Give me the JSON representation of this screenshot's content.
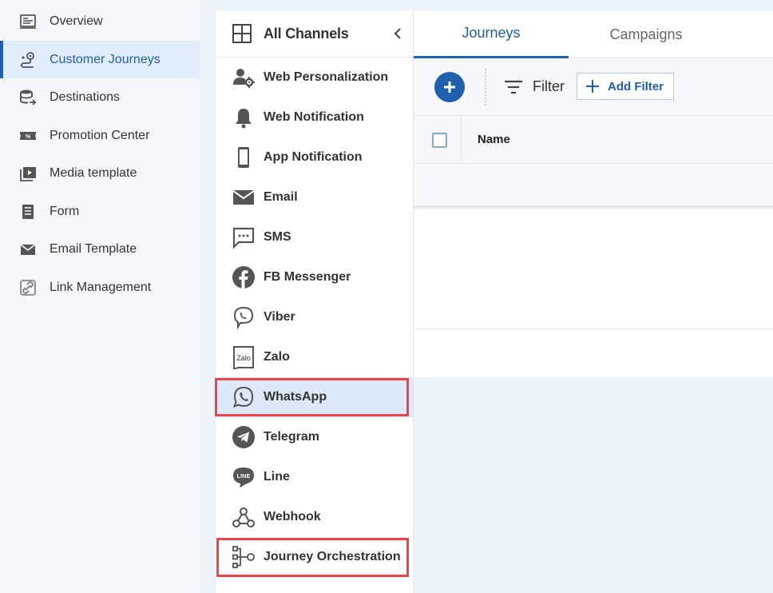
{
  "sidebar": {
    "items": [
      {
        "label": "Overview",
        "icon": "overview-icon"
      },
      {
        "label": "Customer Journeys",
        "icon": "journey-pin-icon",
        "active": true
      },
      {
        "label": "Destinations",
        "icon": "database-arrow-icon"
      },
      {
        "label": "Promotion Center",
        "icon": "coupon-icon"
      },
      {
        "label": "Media template",
        "icon": "media-play-icon"
      },
      {
        "label": "Form",
        "icon": "form-icon"
      },
      {
        "label": "Email Template",
        "icon": "envelope-icon"
      },
      {
        "label": "Link Management",
        "icon": "link-icon"
      }
    ]
  },
  "channels": {
    "header": "All Channels",
    "items": [
      {
        "label": "Web Personalization",
        "icon": "web-personalization-icon"
      },
      {
        "label": "Web Notification",
        "icon": "bell-icon"
      },
      {
        "label": "App Notification",
        "icon": "mobile-phone-icon"
      },
      {
        "label": "Email",
        "icon": "envelope-icon"
      },
      {
        "label": "SMS",
        "icon": "sms-bubble-icon"
      },
      {
        "label": "FB Messenger",
        "icon": "facebook-icon"
      },
      {
        "label": "Viber",
        "icon": "viber-icon"
      },
      {
        "label": "Zalo",
        "icon": "zalo-icon",
        "icon_text": "Zalo"
      },
      {
        "label": "WhatsApp",
        "icon": "whatsapp-icon",
        "highlighted": true
      },
      {
        "label": "Telegram",
        "icon": "telegram-icon"
      },
      {
        "label": "Line",
        "icon": "line-icon",
        "icon_text": "LINE"
      },
      {
        "label": "Webhook",
        "icon": "webhook-icon"
      },
      {
        "label": "Journey Orchestration",
        "icon": "orchestration-icon"
      }
    ]
  },
  "main": {
    "tabs": [
      {
        "label": "Journeys",
        "active": true
      },
      {
        "label": "Campaigns",
        "active": false
      }
    ],
    "toolbar": {
      "filter_label": "Filter",
      "add_filter_label": "Add Filter"
    },
    "table": {
      "columns": [
        "Name"
      ]
    }
  },
  "colors": {
    "accent": "#1f5fad",
    "highlight_box": "#e8454b",
    "active_bg": "#e2edfb"
  }
}
